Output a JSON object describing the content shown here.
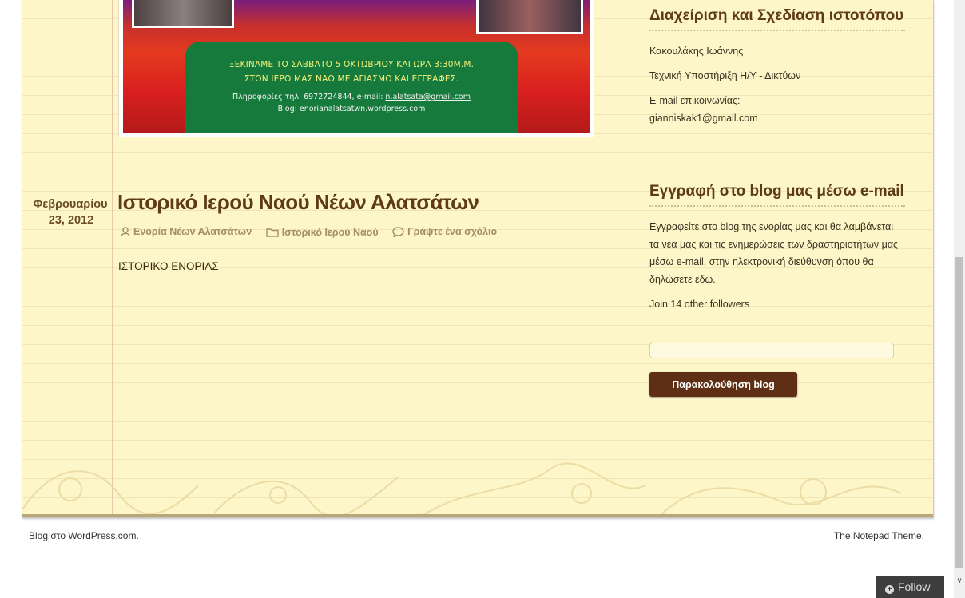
{
  "flyer": {
    "line1": "ΞΕΚΙΝΑΜΕ ΤΟ ΣΑΒΒΑΤΟ 5 ΟΚΤΩΒΡΙΟΥ ΚΑΙ ΩΡΑ 3:30Μ.Μ.",
    "line2": "ΣΤΟΝ ΙΕΡΟ ΜΑΣ ΝΑΟ ΜΕ ΑΓΙΑΣΜΟ ΚΑΙ ΕΓΓΡΑΦΕΣ.",
    "info_prefix": "Πληροφορίες τηλ. 6972724844, e-mail: ",
    "info_email": "n.alatsata@gmail.com",
    "blog": "Blog: enorianalatsatwn.wordpress.com"
  },
  "post": {
    "date_month": "Φεβρουαρίου",
    "date_day": "23, 2012",
    "title": "Ιστορικό Ιερού Ναού Νέων Αλατσάτων",
    "author": "Ενορία Νέων Αλατσάτων",
    "category": "Ιστορικό Ιερού Ναού",
    "comment": "Γράψτε ένα σχόλιο",
    "link": "ΙΣΤΟΡΙΚΟ ΕΝΟΡΙΑΣ"
  },
  "sidebar": {
    "admin": {
      "title": "Διαχείριση και Σχεδίαση ιστοτόπου",
      "name": "Κακουλάκης Ιωάννης",
      "support": "Τεχνική Υποστήριξη Η/Υ - Δικτύων",
      "email_label": "E-mail επικοινωνίας:",
      "email": "gianniskak1@gmail.com"
    },
    "subscribe": {
      "title": "Εγγραφή στο blog μας μέσω e-mail",
      "description": "Εγγραφείτε στο blog της ενορίας μας και θα λαμβάνεται τα νέα μας και τις ενημερώσεις των δραστηριοτήτων μας μέσω e-mail, στην ηλεκτρονική διεύθυνση όπου θα δηλώσετε εδώ.",
      "followers": "Join 14 other followers",
      "email_value": "",
      "button": "Παρακολούθηση blog"
    }
  },
  "footer": {
    "left": "Blog στο WordPress.com.",
    "right": "The Notepad Theme."
  },
  "follow_button": "Follow",
  "colors": {
    "paper": "#fdf6c8",
    "heading": "#5e3a17",
    "button": "#5e2f14",
    "flyer_box": "#167a3c"
  },
  "icons": [
    "person-icon",
    "folder-icon",
    "comment-icon",
    "plus-circle-icon",
    "chevron-down-icon"
  ]
}
